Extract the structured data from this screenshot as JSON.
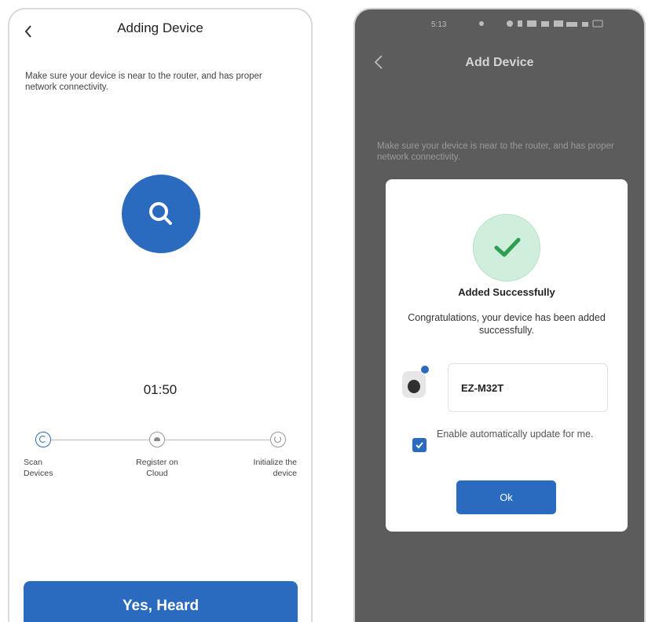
{
  "left_screen": {
    "back_icon": "chevron-left-icon",
    "title": "Adding Device",
    "hint": "Make sure your device is near to the router, and has proper network connectivity.",
    "scan_icon": "search-icon",
    "timer": "01:50",
    "steps": [
      {
        "label": "Scan Devices",
        "icon": "scan-spinner-icon",
        "state": "active"
      },
      {
        "label": "Register on Cloud",
        "icon": "cloud-icon",
        "state": "pending"
      },
      {
        "label": "Initialize the device",
        "icon": "refresh-icon",
        "state": "pending"
      }
    ],
    "cta_label": "Yes, Heard",
    "accent": "#2a6bc0"
  },
  "right_screen": {
    "status_time": "5:13",
    "back_icon": "chevron-left-icon",
    "title": "Add Device",
    "hint": "Make sure your device is near to the router, and has proper network connectivity.",
    "dialog": {
      "success_icon": "checkmark-icon",
      "title": "Added Successfully",
      "message": "Congratulations, your device has been added successfully.",
      "device_name": "EZ-M32T",
      "auto_update_label": "Enable automatically update for me.",
      "auto_update_checked": true,
      "ok_label": "Ok"
    },
    "colors": {
      "overlay": "#5c5c5c",
      "success_bg": "#cfeedb",
      "success_check": "#2e9e52",
      "accent": "#2a6bc0"
    }
  }
}
